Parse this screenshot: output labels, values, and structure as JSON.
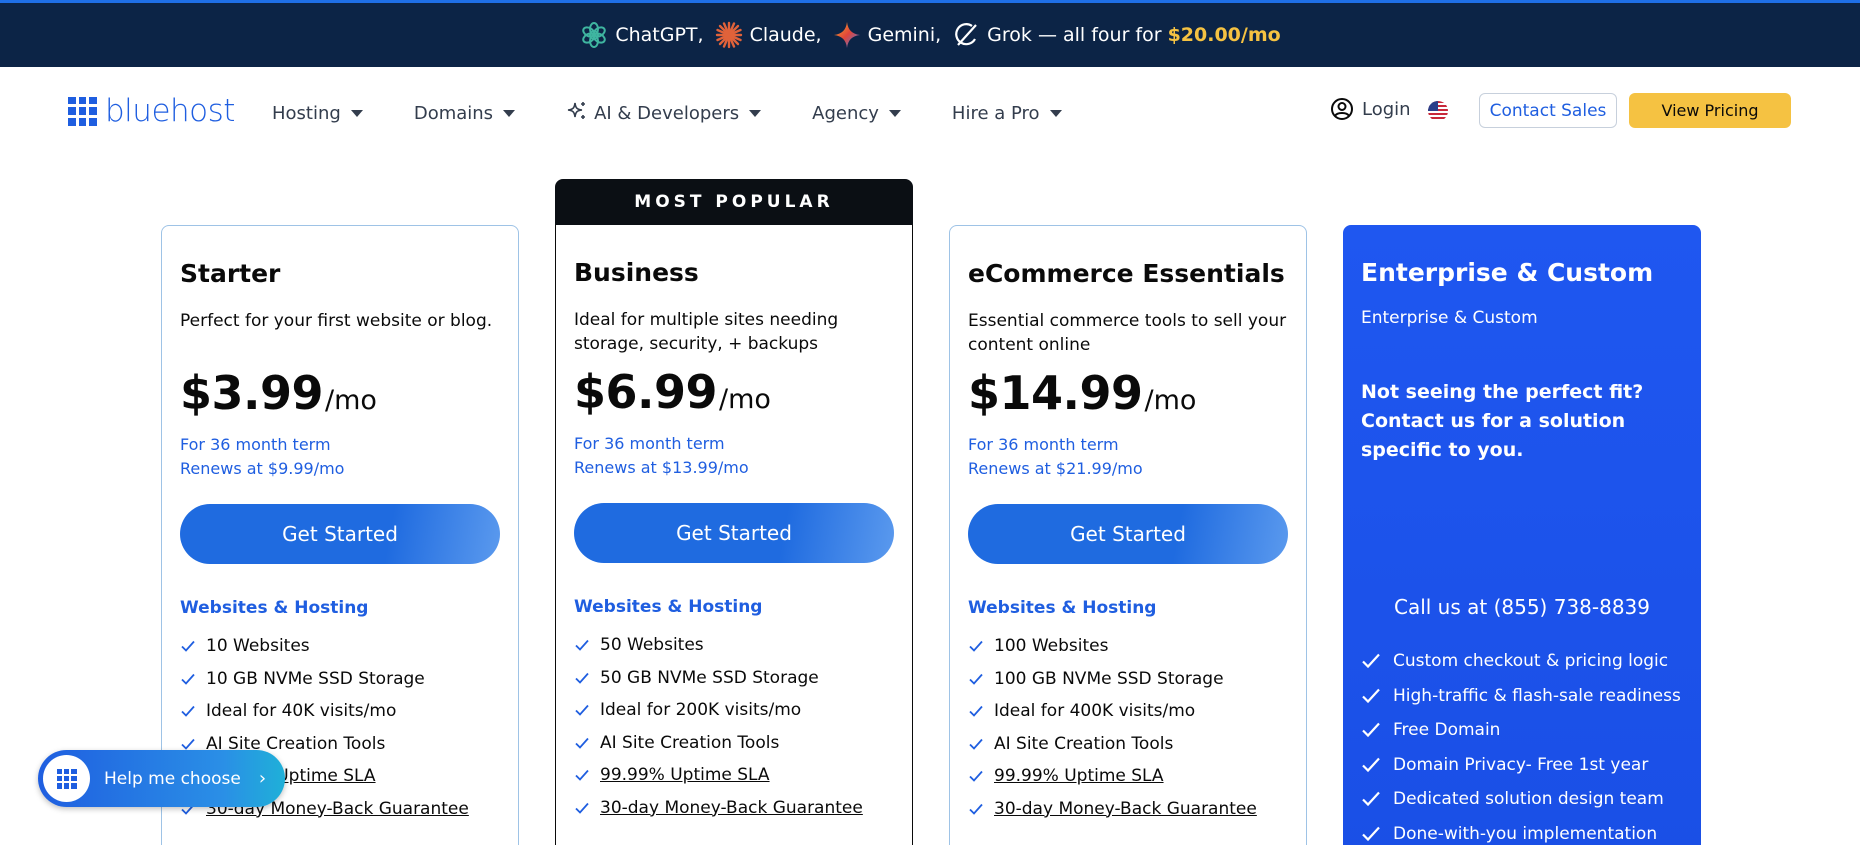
{
  "promo": {
    "chatgpt": "ChatGPT,",
    "claude": "Claude,",
    "gemini": "Gemini,",
    "grok": "Grok — all four for",
    "price": "$20.00/mo"
  },
  "header": {
    "logo": "bluehost",
    "nav": [
      "Hosting",
      "Domains",
      "AI & Developers",
      "Agency",
      "Hire a Pro"
    ],
    "login": "Login",
    "contact_sales": "Contact Sales",
    "view_pricing": "View Pricing"
  },
  "badge": "MOST POPULAR",
  "plans": [
    {
      "title": "Starter",
      "desc": "Perfect for your first website or blog.",
      "price": "$3.99",
      "unit": "/mo",
      "term": "For 36 month term",
      "renews": "Renews at $9.99/mo",
      "cta": "Get Started",
      "section": "Websites & Hosting",
      "features": [
        "10 Websites",
        "10 GB NVMe SSD Storage",
        "Ideal for 40K visits/mo",
        "AI Site Creation Tools",
        "99.99% Uptime SLA",
        "30-day Money-Back Guarantee"
      ]
    },
    {
      "title": "Business",
      "desc": "Ideal for multiple sites needing storage, security, + backups",
      "price": "$6.99",
      "unit": "/mo",
      "term": "For 36 month term",
      "renews": "Renews at $13.99/mo",
      "cta": "Get Started",
      "section": "Websites & Hosting",
      "features": [
        "50 Websites",
        "50 GB NVMe SSD Storage",
        "Ideal for 200K visits/mo",
        "AI Site Creation Tools",
        "99.99% Uptime SLA",
        "30-day Money-Back Guarantee"
      ]
    },
    {
      "title": "eCommerce Essentials",
      "desc": "Essential commerce tools to sell your content online",
      "price": "$14.99",
      "unit": "/mo",
      "term": "For 36 month term",
      "renews": "Renews at $21.99/mo",
      "cta": "Get Started",
      "section": "Websites & Hosting",
      "features": [
        "100 Websites",
        "100 GB NVMe SSD Storage",
        "Ideal for 400K visits/mo",
        "AI Site Creation Tools",
        "99.99% Uptime SLA",
        "30-day Money-Back Guarantee"
      ]
    }
  ],
  "enterprise": {
    "title": "Enterprise & Custom",
    "sub": "Enterprise & Custom",
    "pitch": "Not seeing the perfect fit? Contact us for a solution specific to you.",
    "call": "Call us at (855) 738-8839",
    "features": [
      "Custom checkout & pricing logic",
      "High-traffic & flash-sale readiness",
      "Free Domain",
      "Domain Privacy- Free 1st year",
      "Dedicated solution design team",
      "Done-with-you implementation"
    ]
  },
  "help": {
    "label": "Help me choose",
    "chevron": "›"
  }
}
